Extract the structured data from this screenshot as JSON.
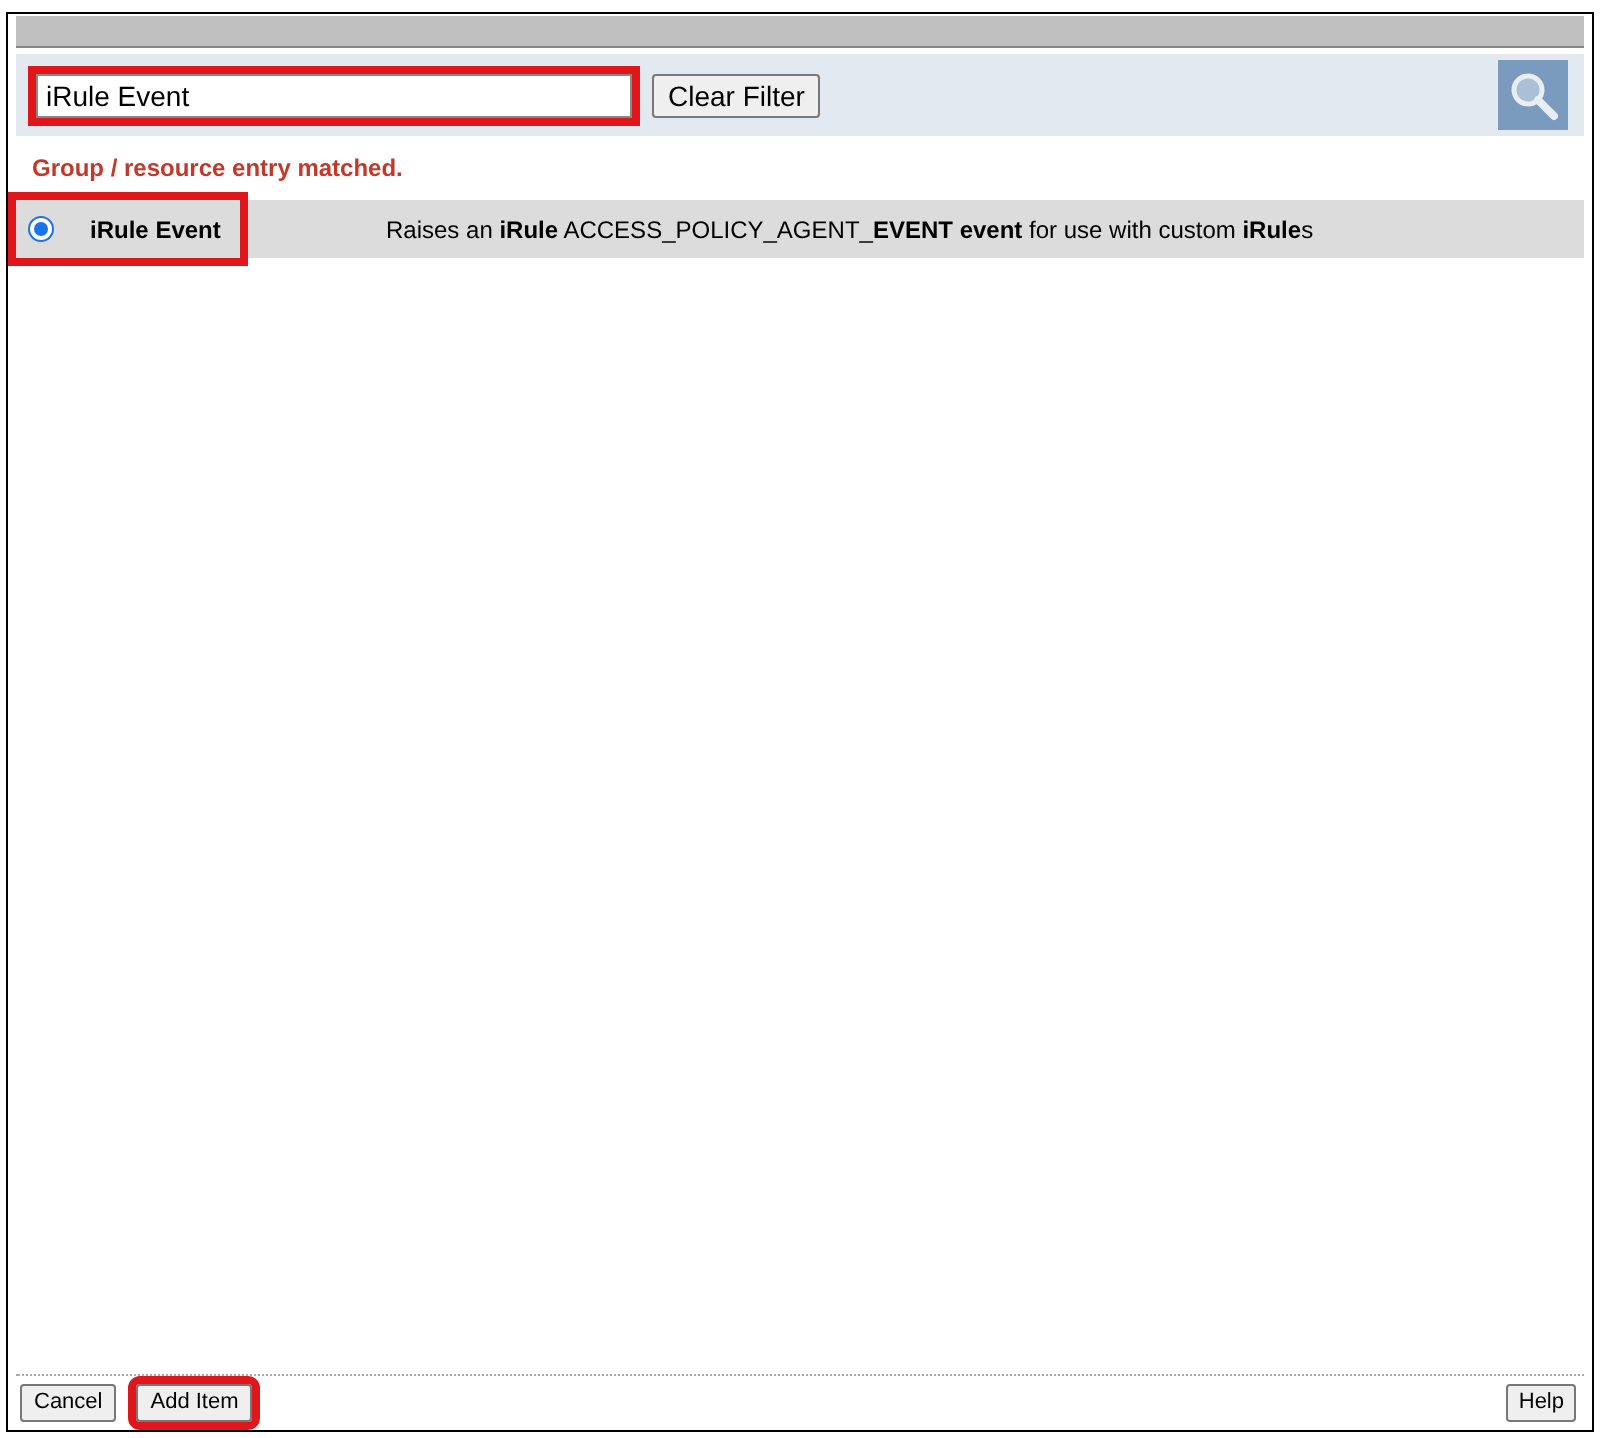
{
  "filter": {
    "value": "iRule Event",
    "highlighted": true,
    "clear_button": "Clear Filter"
  },
  "message": "Group / resource entry matched.",
  "results": [
    {
      "selected": true,
      "highlighted": true,
      "name": "**iRule** **Event**",
      "description": "Raises an **iRule** ACCESS_POLICY_AGENT_**EVENT** **event** for use with custom **iRule**s"
    }
  ],
  "footer": {
    "buttons": [
      {
        "label": "Cancel",
        "highlighted": false
      },
      {
        "label": "Add Item",
        "highlighted": true
      }
    ],
    "help": "Help"
  }
}
